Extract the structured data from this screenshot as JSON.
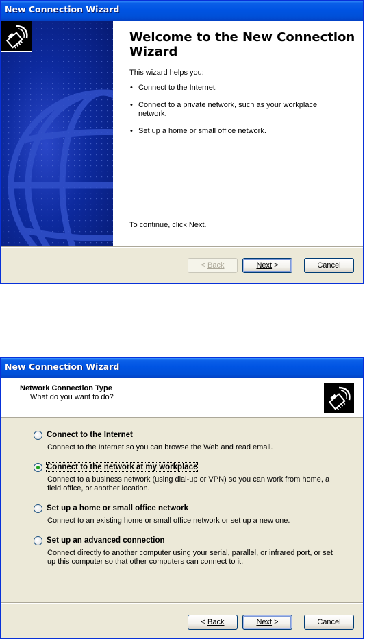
{
  "welcome": {
    "title": "New Connection Wizard",
    "heading": "Welcome to the New Connection Wizard",
    "intro": "This wizard helps you:",
    "bullets": [
      "Connect to the Internet.",
      "Connect to a private network, such as your workplace network.",
      "Set up a home or small office network."
    ],
    "continue_text": "To continue, click Next.",
    "buttons": {
      "back": "Back",
      "next": "Next",
      "cancel": "Cancel"
    }
  },
  "connection_type": {
    "title": "New Connection Wizard",
    "header_title": "Network Connection Type",
    "header_subtitle": "What do you want to do?",
    "options": [
      {
        "label": "Connect to the Internet",
        "description": "Connect to the Internet so you can browse the Web and read email.",
        "selected": false
      },
      {
        "label": "Connect to the network at my workplace",
        "description": "Connect to a business network (using dial-up or VPN) so you can work from home, a field office, or another location.",
        "selected": true
      },
      {
        "label": "Set up a home or small office network",
        "description": "Connect to an existing home or small office network or set up a new one.",
        "selected": false
      },
      {
        "label": "Set up an advanced connection",
        "description": "Connect directly to another computer using your serial, parallel, or infrared port, or set up this computer so that other computers can connect to it.",
        "selected": false
      }
    ],
    "buttons": {
      "back": "Back",
      "next": "Next",
      "cancel": "Cancel"
    }
  },
  "colors": {
    "titlebar": "#0054e3",
    "dialog_bg": "#ece9d8",
    "side_panel": "#0d2a9e",
    "radio_dot": "#21a121"
  },
  "icons": [
    "network-cable-icon",
    "globe-graphic",
    "radio-button"
  ]
}
